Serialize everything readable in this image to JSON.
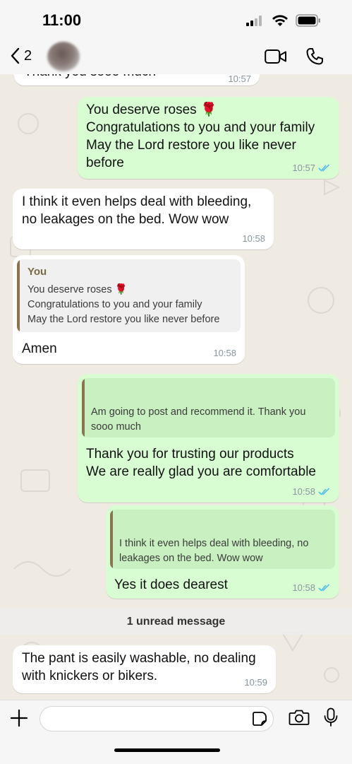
{
  "status_bar": {
    "time": "11:00"
  },
  "header": {
    "back_count": "2"
  },
  "messages": [
    {
      "type": "incoming",
      "text": "Thank you sooo much",
      "time": "10:57"
    },
    {
      "type": "outgoing",
      "text": "You deserve roses 🌹\nCongratulations to you and your family\nMay the Lord restore you like never before",
      "time": "10:57",
      "status": "read"
    },
    {
      "type": "incoming",
      "text": "I think it even helps deal with bleeding,\nno leakages on the bed. Wow wow",
      "time": "10:58"
    },
    {
      "type": "incoming",
      "quote_author": "You",
      "quote_text": "You deserve roses 🌹\nCongratulations to you and your family\nMay the Lord restore you like never before",
      "text": "Amen",
      "time": "10:58"
    },
    {
      "type": "outgoing",
      "quote_text": "Am going to post and recommend it. Thank you\nsooo much",
      "text": "Thank you for trusting our products\nWe are really glad you are comfortable",
      "time": "10:58",
      "status": "read"
    },
    {
      "type": "outgoing",
      "quote_text": "I think it even helps deal with bleeding, no\nleakages on the bed. Wow wow",
      "text": "Yes it does dearest",
      "time": "10:58",
      "status": "read"
    }
  ],
  "unread_divider": "1 unread message",
  "last_message": {
    "type": "incoming",
    "text": "The pant is easily washable, no dealing\nwith knickers or bikers.",
    "time": "10:59"
  },
  "composer": {
    "placeholder": ""
  },
  "icons": {
    "back": "chevron-left-icon",
    "video": "video-call-icon",
    "call": "phone-icon",
    "add": "plus-icon",
    "sticker": "sticker-icon",
    "camera": "camera-icon",
    "mic": "microphone-icon"
  },
  "colors": {
    "outgoing_bubble": "#d9fdd3",
    "incoming_bubble": "#ffffff",
    "read_ticks": "#53bdeb",
    "chat_bg": "#efeae2"
  }
}
